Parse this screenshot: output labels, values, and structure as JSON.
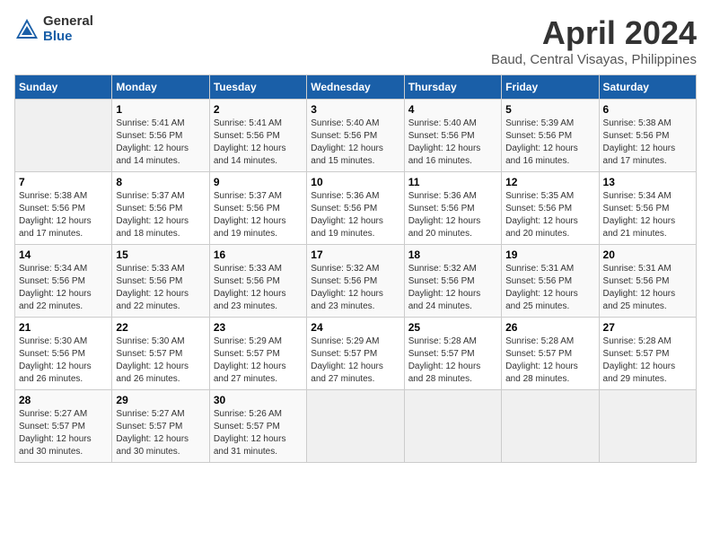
{
  "header": {
    "logo_general": "General",
    "logo_blue": "Blue",
    "title": "April 2024",
    "subtitle": "Baud, Central Visayas, Philippines"
  },
  "calendar": {
    "days_of_week": [
      "Sunday",
      "Monday",
      "Tuesday",
      "Wednesday",
      "Thursday",
      "Friday",
      "Saturday"
    ],
    "weeks": [
      [
        {
          "day": "",
          "info": ""
        },
        {
          "day": "1",
          "info": "Sunrise: 5:41 AM\nSunset: 5:56 PM\nDaylight: 12 hours\nand 14 minutes."
        },
        {
          "day": "2",
          "info": "Sunrise: 5:41 AM\nSunset: 5:56 PM\nDaylight: 12 hours\nand 14 minutes."
        },
        {
          "day": "3",
          "info": "Sunrise: 5:40 AM\nSunset: 5:56 PM\nDaylight: 12 hours\nand 15 minutes."
        },
        {
          "day": "4",
          "info": "Sunrise: 5:40 AM\nSunset: 5:56 PM\nDaylight: 12 hours\nand 16 minutes."
        },
        {
          "day": "5",
          "info": "Sunrise: 5:39 AM\nSunset: 5:56 PM\nDaylight: 12 hours\nand 16 minutes."
        },
        {
          "day": "6",
          "info": "Sunrise: 5:38 AM\nSunset: 5:56 PM\nDaylight: 12 hours\nand 17 minutes."
        }
      ],
      [
        {
          "day": "7",
          "info": "Sunrise: 5:38 AM\nSunset: 5:56 PM\nDaylight: 12 hours\nand 17 minutes."
        },
        {
          "day": "8",
          "info": "Sunrise: 5:37 AM\nSunset: 5:56 PM\nDaylight: 12 hours\nand 18 minutes."
        },
        {
          "day": "9",
          "info": "Sunrise: 5:37 AM\nSunset: 5:56 PM\nDaylight: 12 hours\nand 19 minutes."
        },
        {
          "day": "10",
          "info": "Sunrise: 5:36 AM\nSunset: 5:56 PM\nDaylight: 12 hours\nand 19 minutes."
        },
        {
          "day": "11",
          "info": "Sunrise: 5:36 AM\nSunset: 5:56 PM\nDaylight: 12 hours\nand 20 minutes."
        },
        {
          "day": "12",
          "info": "Sunrise: 5:35 AM\nSunset: 5:56 PM\nDaylight: 12 hours\nand 20 minutes."
        },
        {
          "day": "13",
          "info": "Sunrise: 5:34 AM\nSunset: 5:56 PM\nDaylight: 12 hours\nand 21 minutes."
        }
      ],
      [
        {
          "day": "14",
          "info": "Sunrise: 5:34 AM\nSunset: 5:56 PM\nDaylight: 12 hours\nand 22 minutes."
        },
        {
          "day": "15",
          "info": "Sunrise: 5:33 AM\nSunset: 5:56 PM\nDaylight: 12 hours\nand 22 minutes."
        },
        {
          "day": "16",
          "info": "Sunrise: 5:33 AM\nSunset: 5:56 PM\nDaylight: 12 hours\nand 23 minutes."
        },
        {
          "day": "17",
          "info": "Sunrise: 5:32 AM\nSunset: 5:56 PM\nDaylight: 12 hours\nand 23 minutes."
        },
        {
          "day": "18",
          "info": "Sunrise: 5:32 AM\nSunset: 5:56 PM\nDaylight: 12 hours\nand 24 minutes."
        },
        {
          "day": "19",
          "info": "Sunrise: 5:31 AM\nSunset: 5:56 PM\nDaylight: 12 hours\nand 25 minutes."
        },
        {
          "day": "20",
          "info": "Sunrise: 5:31 AM\nSunset: 5:56 PM\nDaylight: 12 hours\nand 25 minutes."
        }
      ],
      [
        {
          "day": "21",
          "info": "Sunrise: 5:30 AM\nSunset: 5:56 PM\nDaylight: 12 hours\nand 26 minutes."
        },
        {
          "day": "22",
          "info": "Sunrise: 5:30 AM\nSunset: 5:57 PM\nDaylight: 12 hours\nand 26 minutes."
        },
        {
          "day": "23",
          "info": "Sunrise: 5:29 AM\nSunset: 5:57 PM\nDaylight: 12 hours\nand 27 minutes."
        },
        {
          "day": "24",
          "info": "Sunrise: 5:29 AM\nSunset: 5:57 PM\nDaylight: 12 hours\nand 27 minutes."
        },
        {
          "day": "25",
          "info": "Sunrise: 5:28 AM\nSunset: 5:57 PM\nDaylight: 12 hours\nand 28 minutes."
        },
        {
          "day": "26",
          "info": "Sunrise: 5:28 AM\nSunset: 5:57 PM\nDaylight: 12 hours\nand 28 minutes."
        },
        {
          "day": "27",
          "info": "Sunrise: 5:28 AM\nSunset: 5:57 PM\nDaylight: 12 hours\nand 29 minutes."
        }
      ],
      [
        {
          "day": "28",
          "info": "Sunrise: 5:27 AM\nSunset: 5:57 PM\nDaylight: 12 hours\nand 30 minutes."
        },
        {
          "day": "29",
          "info": "Sunrise: 5:27 AM\nSunset: 5:57 PM\nDaylight: 12 hours\nand 30 minutes."
        },
        {
          "day": "30",
          "info": "Sunrise: 5:26 AM\nSunset: 5:57 PM\nDaylight: 12 hours\nand 31 minutes."
        },
        {
          "day": "",
          "info": ""
        },
        {
          "day": "",
          "info": ""
        },
        {
          "day": "",
          "info": ""
        },
        {
          "day": "",
          "info": ""
        }
      ]
    ]
  }
}
